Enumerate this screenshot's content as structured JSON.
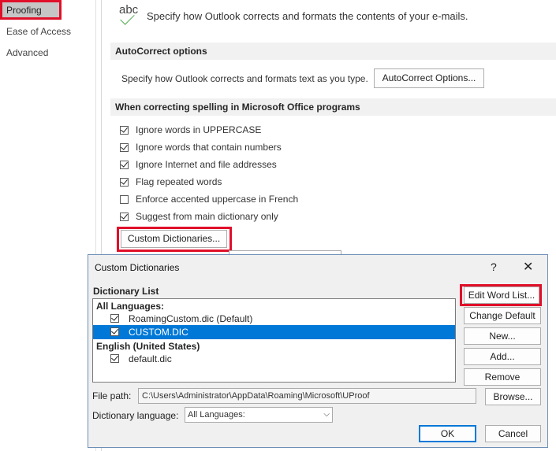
{
  "nav": {
    "items": [
      "Proofing",
      "Ease of Access",
      "Advanced"
    ]
  },
  "header": {
    "abc_glyph": "abc",
    "description": "Specify how Outlook corrects and formats the contents of your e-mails."
  },
  "autocorrect": {
    "title": "AutoCorrect options",
    "text": "Specify how Outlook corrects and formats text as you type.",
    "button": "AutoCorrect Options..."
  },
  "spelling": {
    "title": "When correcting spelling in Microsoft Office programs",
    "options": [
      {
        "label": "Ignore words in UPPERCASE",
        "checked": true
      },
      {
        "label": "Ignore words that contain numbers",
        "checked": true
      },
      {
        "label": "Ignore Internet and file addresses",
        "checked": true
      },
      {
        "label": "Flag repeated words",
        "checked": true
      },
      {
        "label": "Enforce accented uppercase in French",
        "checked": false
      },
      {
        "label": "Suggest from main dictionary only",
        "checked": true
      }
    ],
    "custom_dict_button": "Custom Dictionaries..."
  },
  "dialog": {
    "title": "Custom Dictionaries",
    "help": "?",
    "close": "✕",
    "list_label": "Dictionary List",
    "group1": "All Languages:",
    "items1": [
      {
        "label": "RoamingCustom.dic (Default)",
        "checked": true,
        "selected": false
      },
      {
        "label": "CUSTOM.DIC",
        "checked": true,
        "selected": true
      }
    ],
    "group2": "English (United States)",
    "items2": [
      {
        "label": "default.dic",
        "checked": true,
        "selected": false
      }
    ],
    "buttons": {
      "edit": "Edit Word List...",
      "change_default": "Change Default",
      "new": "New...",
      "add": "Add...",
      "remove": "Remove",
      "browse": "Browse...",
      "ok": "OK",
      "cancel": "Cancel"
    },
    "file_path_label": "File path:",
    "file_path_value": "C:\\Users\\Administrator\\AppData\\Roaming\\Microsoft\\UProof",
    "lang_label": "Dictionary language:",
    "lang_value": "All Languages:"
  },
  "colors": {
    "highlight_red": "#e0102a",
    "selection_blue": "#0078d7",
    "section_bg": "#f1f1f1"
  }
}
